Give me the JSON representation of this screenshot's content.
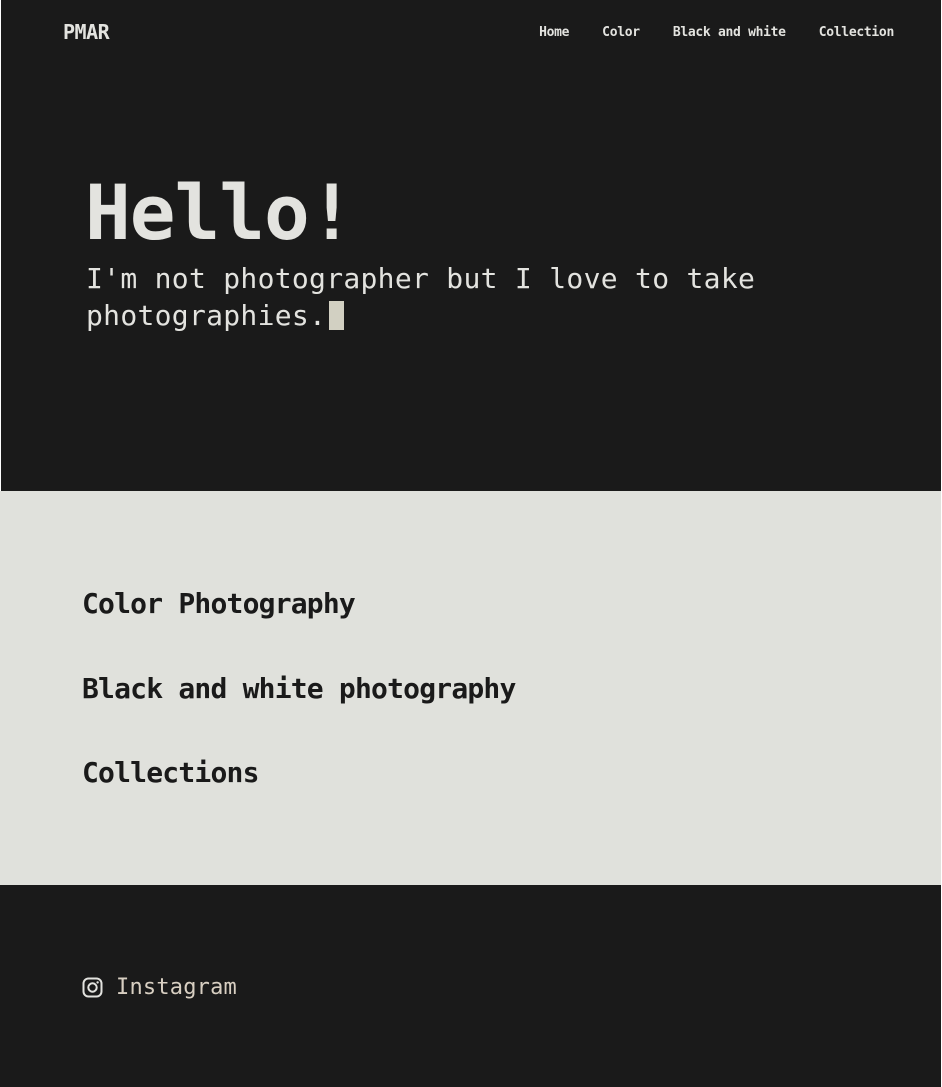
{
  "header": {
    "brand": "PMAR",
    "nav": [
      {
        "label": "Home"
      },
      {
        "label": "Color"
      },
      {
        "label": "Black and white"
      },
      {
        "label": "Collection"
      }
    ]
  },
  "hero": {
    "title": "Hello!",
    "subtitle": "I'm not photographer but I love to take photographies."
  },
  "sections": [
    {
      "label": "Color Photography"
    },
    {
      "label": "Black and white photography"
    },
    {
      "label": "Collections"
    }
  ],
  "footer": {
    "social": {
      "icon": "instagram-icon",
      "label": "Instagram"
    }
  },
  "colors": {
    "dark_background": "#1a1a1a",
    "light_background": "#e0e1dc",
    "light_text": "#e3e3df",
    "cursor": "#d2d0c2"
  }
}
